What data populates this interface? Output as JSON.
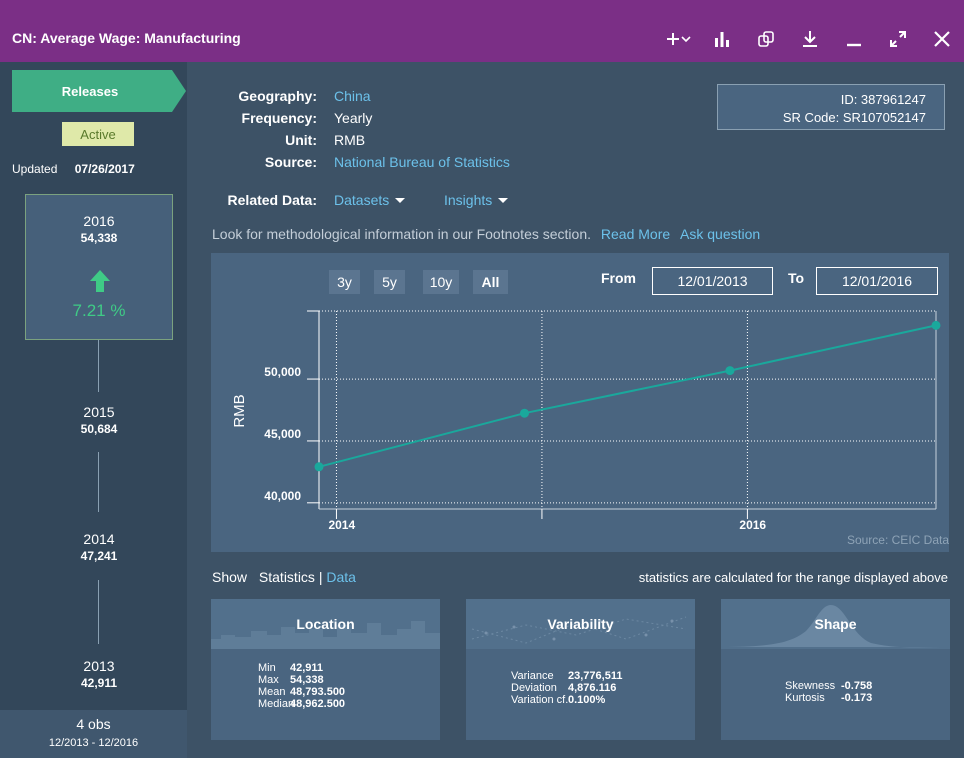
{
  "window": {
    "title": "CN: Average Wage: Manufacturing",
    "icons": [
      "plus-dropdown-icon",
      "bar-chart-icon",
      "copy-icon",
      "download-icon",
      "minimize-icon",
      "expand-icon",
      "close-icon"
    ]
  },
  "sidebar": {
    "releases_label": "Releases",
    "status": "Active",
    "updated_label": "Updated",
    "updated_date": "07/26/2017",
    "latest": {
      "year": "2016",
      "value": "54,338",
      "change": "7.21 %"
    },
    "history": [
      {
        "year": "2015",
        "value": "50,684"
      },
      {
        "year": "2014",
        "value": "47,241"
      },
      {
        "year": "2013",
        "value": "42,911"
      }
    ],
    "obs_count": "4 obs",
    "obs_range": "12/2013 - 12/2016"
  },
  "meta": {
    "geography_label": "Geography:",
    "geography": "China",
    "frequency_label": "Frequency:",
    "frequency": "Yearly",
    "unit_label": "Unit:",
    "unit": "RMB",
    "source_label": "Source:",
    "source": "National Bureau of Statistics",
    "related_label": "Related Data:",
    "datasets": "Datasets",
    "insights": "Insights",
    "id": "ID: 387961247",
    "sr_code": "SR Code: SR107052147",
    "note": "Look for methodological information in our Footnotes section.",
    "read_more": "Read More",
    "ask_question": "Ask question"
  },
  "chart_controls": {
    "ranges": [
      "3y",
      "5y",
      "10y",
      "All"
    ],
    "selected": "All",
    "from_label": "From",
    "from_value": "12/01/2013",
    "to_label": "To",
    "to_value": "12/01/2016"
  },
  "chart_data": {
    "type": "line",
    "ylabel": "RMB",
    "x": [
      "2013-12",
      "2014-12",
      "2015-12",
      "2016-12"
    ],
    "x_ticks": [
      "2014",
      "2016"
    ],
    "series": [
      {
        "values": [
          42911,
          47241,
          50684,
          54338
        ]
      }
    ],
    "y_ticks": [
      "40,000",
      "45,000",
      "50,000"
    ],
    "ylim": [
      39500,
      55500
    ],
    "grid": true,
    "source_note": "Source: CEIC Data",
    "color": "#1aa89c"
  },
  "stats": {
    "show_label": "Show",
    "statistics_label": "Statistics",
    "separator": "|",
    "data_label": "Data",
    "note": "statistics are calculated for the range displayed above",
    "location": {
      "title": "Location",
      "rows": [
        {
          "k": "Min",
          "v": "42,911"
        },
        {
          "k": "Max",
          "v": "54,338"
        },
        {
          "k": "Mean",
          "v": "48,793.500"
        },
        {
          "k": "Median",
          "v": "48,962.500"
        }
      ]
    },
    "variability": {
      "title": "Variability",
      "rows": [
        {
          "k": "Variance",
          "v": "23,776,511"
        },
        {
          "k": "Deviation",
          "v": "4,876.116"
        },
        {
          "k": "Variation cf.",
          "v": "0.100%"
        }
      ]
    },
    "shape": {
      "title": "Shape",
      "rows": [
        {
          "k": "Skewness",
          "v": "-0.758"
        },
        {
          "k": "Kurtosis",
          "v": "-0.173"
        }
      ]
    }
  }
}
